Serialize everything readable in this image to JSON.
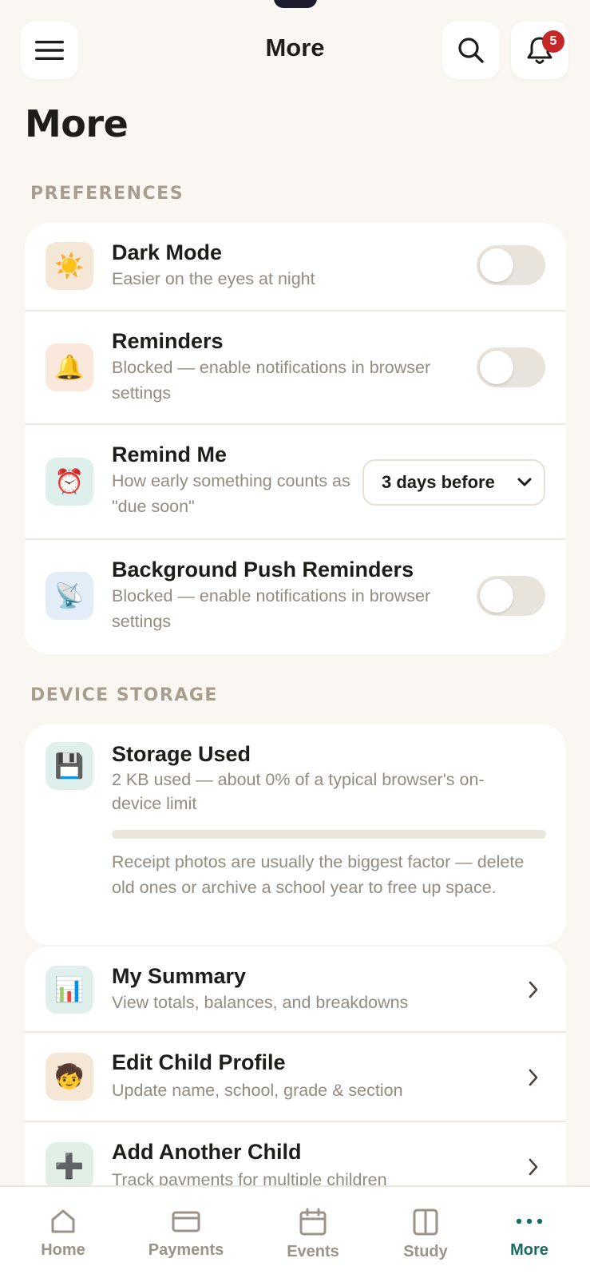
{
  "header": {
    "title": "More",
    "notification_count": "5"
  },
  "page_title": "More",
  "preferences": {
    "label": "PREFERENCES",
    "items": [
      {
        "title": "Dark Mode",
        "subtitle": "Easier on the eyes at night",
        "icon": "sun-icon",
        "glyph": "☀️",
        "control": "toggle",
        "on": false
      },
      {
        "title": "Reminders",
        "subtitle": "Blocked — enable notifications in browser settings",
        "icon": "bell-icon",
        "glyph": "🔔",
        "control": "toggle",
        "on": false
      },
      {
        "title": "Remind Me",
        "subtitle": "How early something counts as \"due soon\"",
        "icon": "alarm-clock-icon",
        "glyph": "⏰",
        "control": "select",
        "selected": "3 days before"
      },
      {
        "title": "Background Push Reminders",
        "subtitle": "Blocked — enable notifications in browser settings",
        "icon": "satellite-dish-icon",
        "glyph": "📡",
        "control": "toggle",
        "on": false
      }
    ]
  },
  "device_storage": {
    "label": "DEVICE STORAGE",
    "title": "Storage Used",
    "subtitle": "2 KB used — about 0% of a typical browser's on-device limit",
    "percent_used": 0,
    "note": "Receipt photos are usually the biggest factor — delete old ones or archive a school year to free up space.",
    "icon": "floppy-disk-icon",
    "glyph": "💾"
  },
  "links": [
    {
      "title": "My Summary",
      "subtitle": "View totals, balances, and breakdowns",
      "icon": "bar-chart-icon",
      "glyph": "📊"
    },
    {
      "title": "Edit Child Profile",
      "subtitle": "Update name, school, grade & section",
      "icon": "child-icon",
      "glyph": "🧒"
    },
    {
      "title": "Add Another Child",
      "subtitle": "Track payments for multiple children",
      "icon": "plus-icon",
      "glyph": "➕"
    }
  ],
  "nav": {
    "items": [
      {
        "label": "Home",
        "icon": "home-icon"
      },
      {
        "label": "Payments",
        "icon": "card-icon"
      },
      {
        "label": "Events",
        "icon": "calendar-icon"
      },
      {
        "label": "Study",
        "icon": "book-icon"
      },
      {
        "label": "More",
        "icon": "more-dots-icon",
        "active": true
      }
    ]
  },
  "colors": {
    "accent": "#1a6b61",
    "badge": "#c62828",
    "background": "#faf7f2"
  }
}
